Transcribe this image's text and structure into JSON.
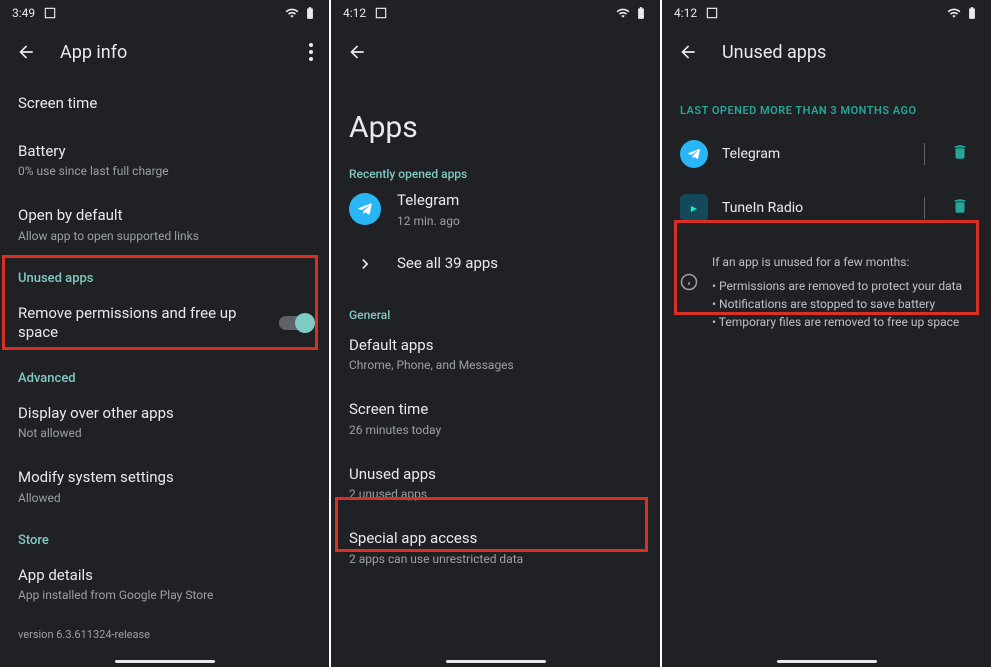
{
  "panel1": {
    "time": "3:49",
    "title": "App info",
    "items": {
      "screen_time": "Screen time",
      "battery_t": "Battery",
      "battery_s": "0% use since last full charge",
      "open_t": "Open by default",
      "open_s": "Allow app to open supported links",
      "unused_h": "Unused apps",
      "remove_t": "Remove permissions and free up space",
      "advanced_h": "Advanced",
      "display_t": "Display over other apps",
      "display_s": "Not allowed",
      "modify_t": "Modify system settings",
      "modify_s": "Allowed",
      "store_h": "Store",
      "details_t": "App details",
      "details_s": "App installed from Google Play Store",
      "version": "version 6.3.611324-release"
    }
  },
  "panel2": {
    "time": "4:12",
    "big_title": "Apps",
    "recent_h": "Recently opened apps",
    "telegram_t": "Telegram",
    "telegram_s": "12 min. ago",
    "see_all": "See all 39 apps",
    "general_h": "General",
    "default_t": "Default apps",
    "default_s": "Chrome, Phone, and Messages",
    "screen_t": "Screen time",
    "screen_s": "26 minutes today",
    "unused_t": "Unused apps",
    "unused_s": "2 unused apps",
    "special_t": "Special app access",
    "special_s": "2 apps can use unrestricted data"
  },
  "panel3": {
    "time": "4:12",
    "title": "Unused apps",
    "section_h": "LAST OPENED MORE THAN 3 MONTHS AGO",
    "app1": "Telegram",
    "app2": "TuneIn Radio",
    "info_intro": "If an app is unused for a few months:",
    "info_b1": "Permissions are removed to protect your data",
    "info_b2": "Notifications are stopped to save battery",
    "info_b3": "Temporary files are removed to free up space"
  }
}
